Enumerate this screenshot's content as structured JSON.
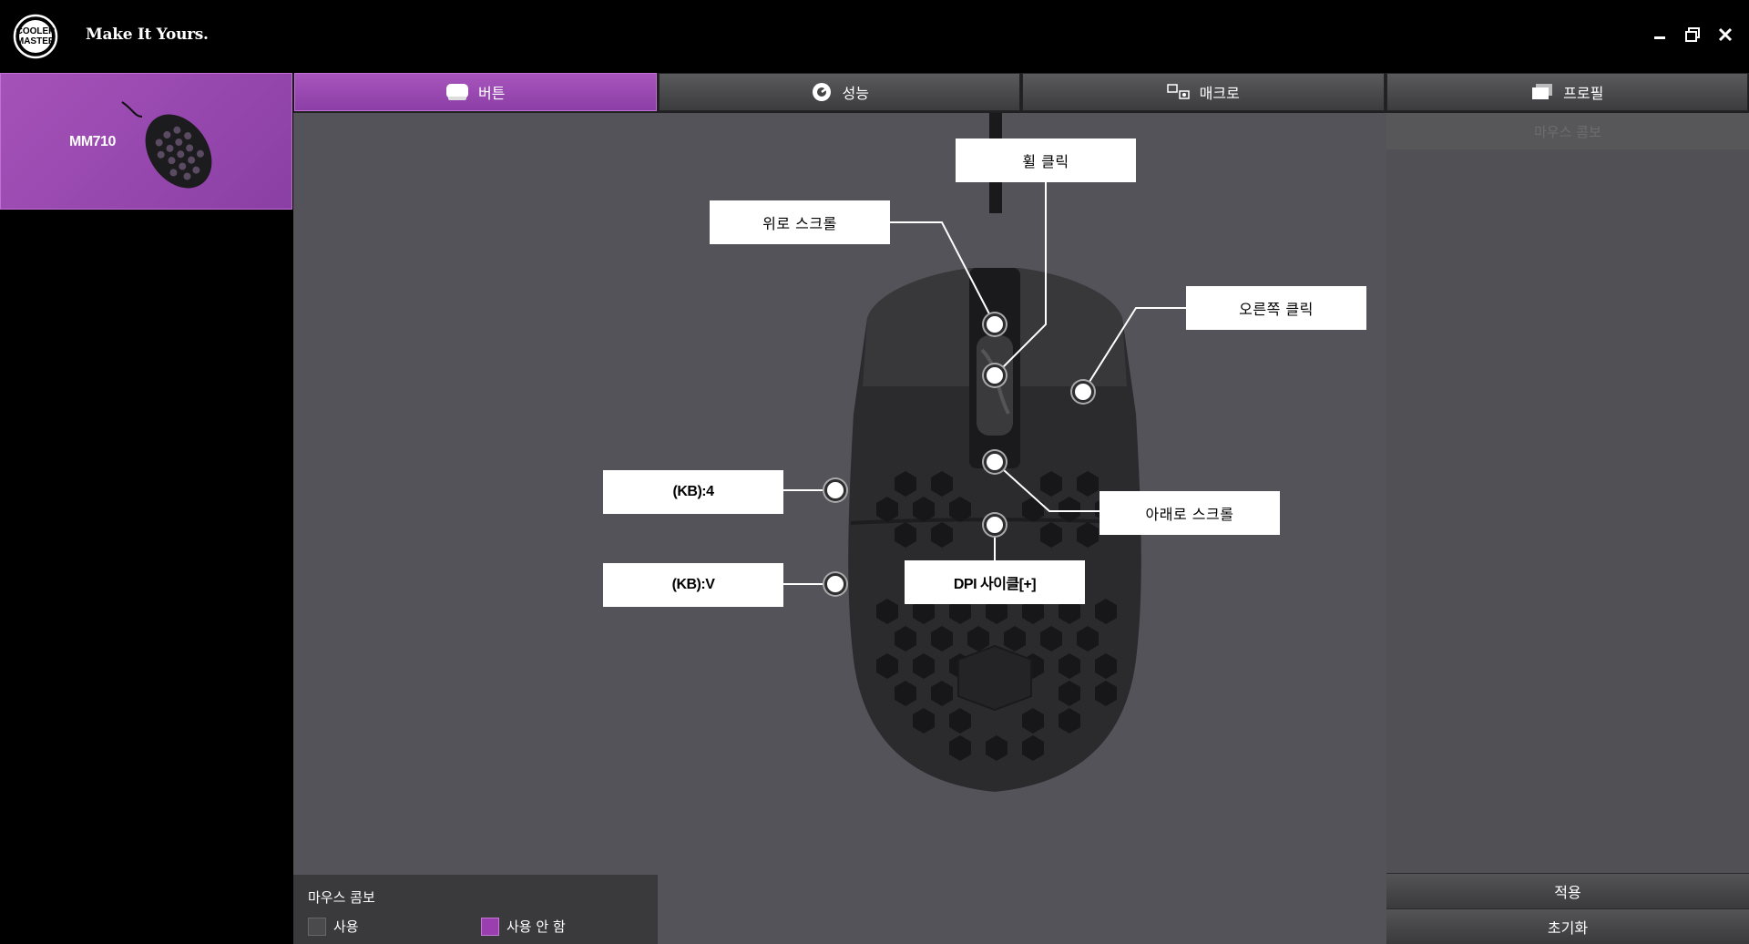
{
  "app": {
    "brand_slogan": "Make It Yours.",
    "logo_lines": [
      "COOLER",
      "MASTER"
    ],
    "window_controls": [
      "minimize-icon",
      "restore-icon",
      "close-icon"
    ]
  },
  "device": {
    "name": "MM710"
  },
  "tabs": [
    {
      "label": "버튼",
      "icon": "mouse-icon",
      "active": true
    },
    {
      "label": "성능",
      "icon": "gauge-icon",
      "active": false
    },
    {
      "label": "매크로",
      "icon": "macro-icon",
      "active": false
    },
    {
      "label": "프로필",
      "icon": "profile-cards-icon",
      "active": false
    }
  ],
  "callouts": {
    "wheel_click": "휠 클릭",
    "scroll_up": "위로 스크롤",
    "right_click": "오른쪽 클릭",
    "side_button_1": "(KB):4",
    "side_button_2": "(KB):V",
    "scroll_down": "아래로 스크롤",
    "dpi_cycle": "DPI 사이클[+]"
  },
  "right_panel": {
    "header": "마우스 콤보",
    "apply": "적용",
    "reset": "초기화"
  },
  "combo": {
    "title": "마우스 콤보",
    "option_use": "사용",
    "option_disable": "사용 안 함",
    "selected": "사용 안 함",
    "colors": {
      "use": "#4a4a4d",
      "disable": "#9b3fb0"
    }
  },
  "colors": {
    "accent": "#9b4fb5",
    "background": "#535359"
  }
}
